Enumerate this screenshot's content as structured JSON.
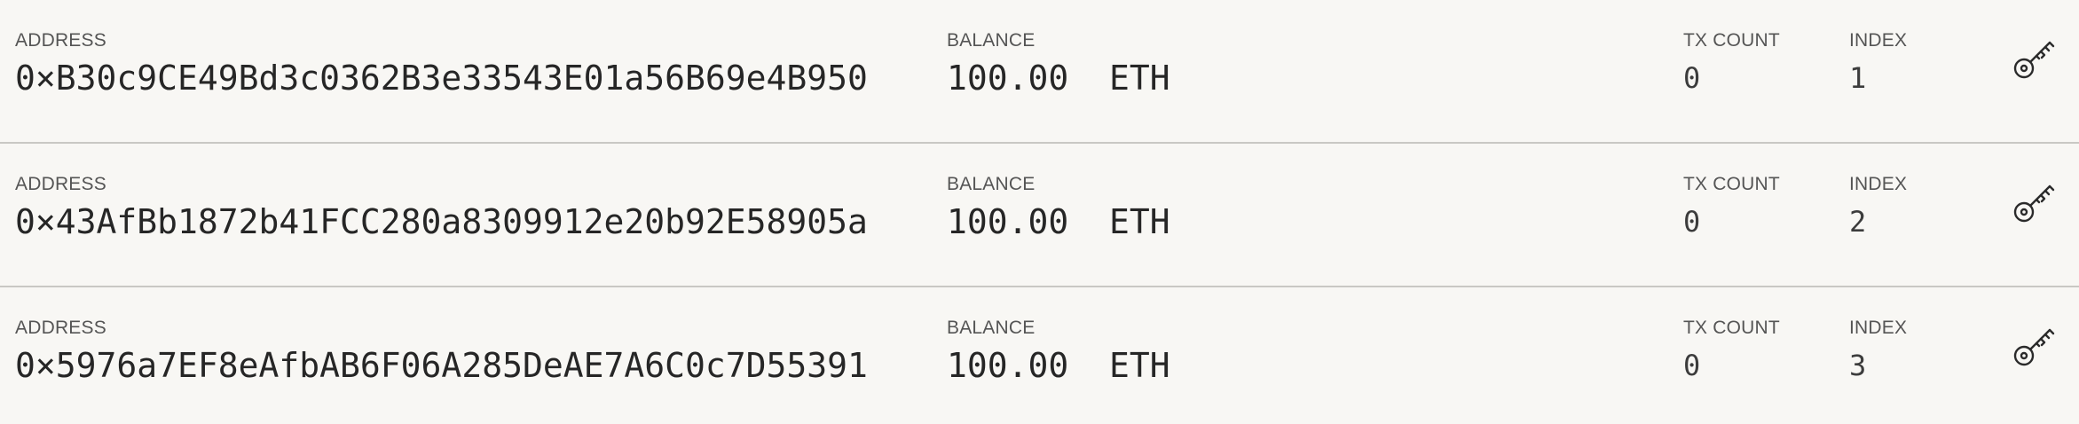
{
  "labels": {
    "address": "ADDRESS",
    "balance": "BALANCE",
    "tx_count": "TX COUNT",
    "index": "INDEX"
  },
  "accounts": [
    {
      "address": "0×B30c9CE49Bd3c0362B3e33543E01a56B69e4B950",
      "balance": "100.00  ETH",
      "tx_count": "0",
      "index": "1",
      "icon": "key-icon"
    },
    {
      "address": "0×43AfBb1872b41FCC280a8309912e20b92E58905a",
      "balance": "100.00  ETH",
      "tx_count": "0",
      "index": "2",
      "icon": "key-icon"
    },
    {
      "address": "0×5976a7EF8eAfbAB6F06A285DeAE7A6C0c7D55391",
      "balance": "100.00  ETH",
      "tx_count": "0",
      "index": "3",
      "icon": "key-icon"
    }
  ],
  "colors": {
    "background": "#f8f7f4",
    "divider": "#c9c8c4",
    "text": "#262626",
    "label": "#555555"
  }
}
